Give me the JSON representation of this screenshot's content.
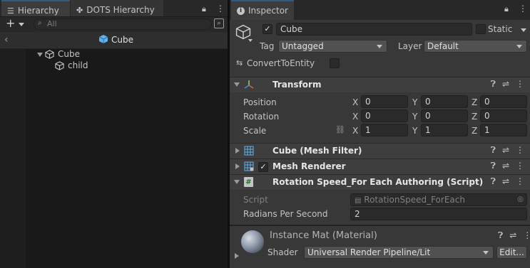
{
  "hierarchy_panel": {
    "tabs": [
      {
        "label": "Hierarchy",
        "icon": "list-icon"
      },
      {
        "label": "DOTS Hierarchy",
        "icon": "dots-icon"
      }
    ],
    "add_button": "+",
    "search_placeholder": "All",
    "scene_title": "Cube",
    "tree": [
      {
        "label": "Cube",
        "icon": "cube-icon"
      },
      {
        "label": "child",
        "icon": "cube-icon"
      }
    ]
  },
  "inspector": {
    "tab_label": "Inspector",
    "object_name": "Cube",
    "static_label": "Static",
    "tag_label": "Tag",
    "tag_value": "Untagged",
    "layer_label": "Layer",
    "layer_value": "Default",
    "convert_label": "ConvertToEntity",
    "transform": {
      "title": "Transform",
      "rows": [
        {
          "label": "Position",
          "x": "0",
          "y": "0",
          "z": "0"
        },
        {
          "label": "Rotation",
          "x": "0",
          "y": "0",
          "z": "0"
        },
        {
          "label": "Scale",
          "x": "1",
          "y": "1",
          "z": "1"
        }
      ],
      "axis_x": "X",
      "axis_y": "Y",
      "axis_z": "Z"
    },
    "mesh_filter_title": "Cube (Mesh Filter)",
    "mesh_renderer_title": "Mesh Renderer",
    "script_component": {
      "title": "Rotation Speed_For Each Authoring (Script)",
      "script_label": "Script",
      "script_value": "RotationSpeed_ForEach",
      "radians_label": "Radians Per Second",
      "radians_value": "2"
    },
    "material": {
      "name": "Instance Mat (Material)",
      "shader_label": "Shader",
      "shader_value": "Universal Render Pipeline/Lit",
      "edit_button": "Edit..."
    }
  },
  "colors": {
    "panel_bg": "#191919",
    "tab_bg": "#282828",
    "active_tab_accent": "#2c5d87",
    "cube_blue": "#5fb3ea",
    "transform_header_bg": "#3e3e3e"
  }
}
